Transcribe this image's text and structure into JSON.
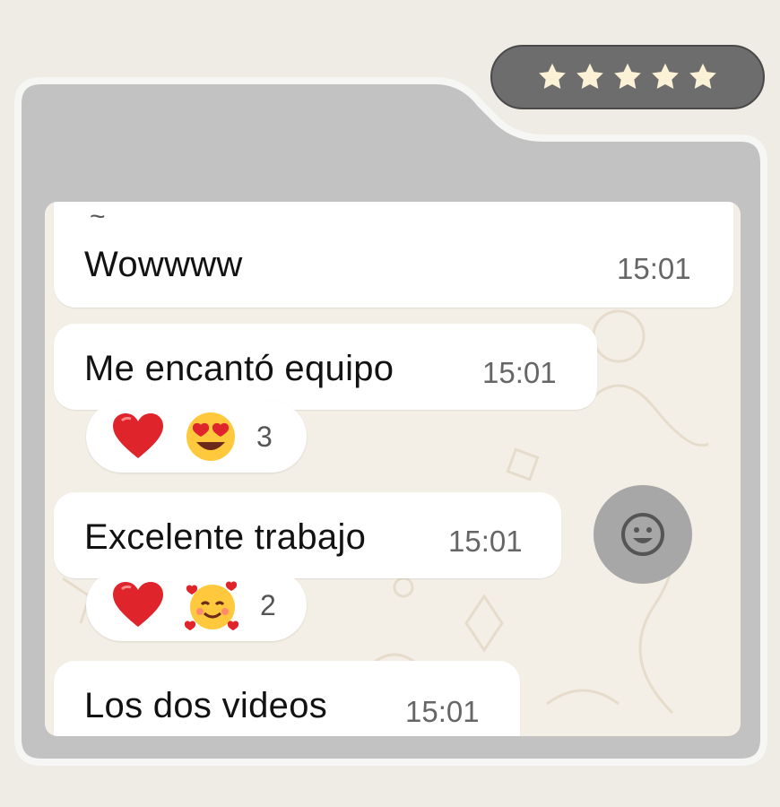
{
  "rating": {
    "stars": 5,
    "star_color": "#fbf1d6"
  },
  "messages": [
    {
      "text": "Wowwww",
      "time": "15:01"
    },
    {
      "text": "Me encantó equipo",
      "time": "15:01",
      "reactions": {
        "emojis": [
          "red-heart",
          "heart-eyes-face"
        ],
        "count": "3"
      }
    },
    {
      "text": "Excelente trabajo",
      "time": "15:01",
      "reactions": {
        "emojis": [
          "red-heart",
          "smiling-face-with-hearts"
        ],
        "count": "2"
      }
    },
    {
      "text": "Los dos videos",
      "time": "15:01"
    }
  ],
  "partial_sender": "~",
  "emoji_button": {
    "icon": "smiley-icon"
  },
  "colors": {
    "page_bg": "#efece6",
    "folder": "#c2c2c2",
    "chat_bg": "#f4efe6",
    "bubble": "#ffffff"
  }
}
